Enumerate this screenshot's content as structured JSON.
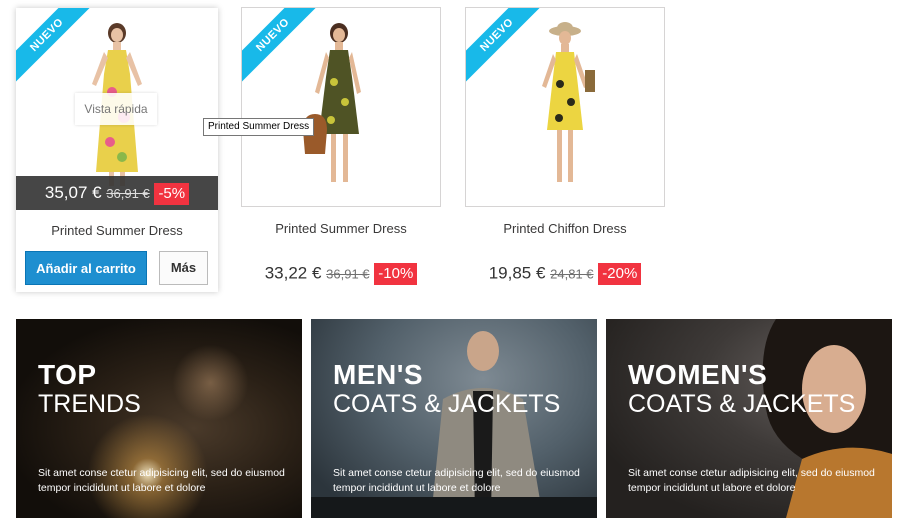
{
  "products": [
    {
      "badge": "NUEVO",
      "name": "Printed Summer Dress",
      "price": "35,07 €",
      "old_price": "36,91 €",
      "discount": "-5%",
      "quick_view": "Vista rápida",
      "add_to_cart": "Añadir al carrito",
      "more": "Más"
    },
    {
      "badge": "NUEVO",
      "name": "Printed Summer Dress",
      "price": "33,22 €",
      "old_price": "36,91 €",
      "discount": "-10%"
    },
    {
      "badge": "NUEVO",
      "name": "Printed Chiffon Dress",
      "price": "19,85 €",
      "old_price": "24,81 €",
      "discount": "-20%"
    }
  ],
  "tooltip": "Printed Summer Dress",
  "banners": [
    {
      "title": "TOP",
      "subtitle": "TRENDS",
      "text": "Sit amet conse ctetur adipisicing elit, sed do eiusmod tempor incididunt ut labore et dolore"
    },
    {
      "title": "MEN'S",
      "subtitle": "COATS & JACKETS",
      "text": "Sit amet conse ctetur adipisicing elit, sed do eiusmod tempor incididunt ut labore et dolore"
    },
    {
      "title": "WOMEN'S",
      "subtitle": "COATS & JACKETS",
      "text": "Sit amet conse ctetur adipisicing elit, sed do eiusmod tempor incididunt ut labore et dolore"
    }
  ],
  "colors": {
    "badge": "#18b9e9",
    "discount": "#f13340",
    "cart_button": "#1e8fd0"
  }
}
